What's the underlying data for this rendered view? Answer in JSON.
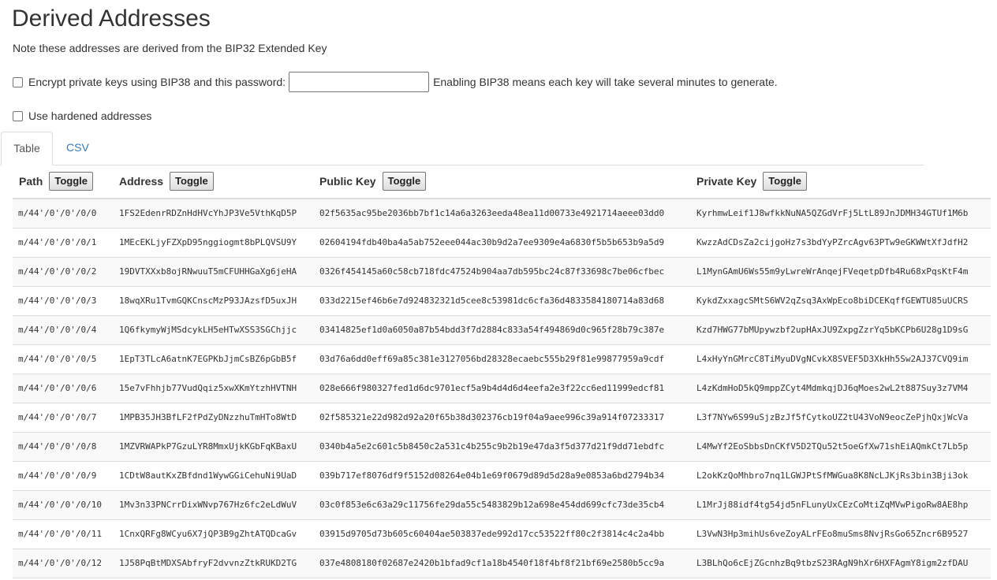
{
  "page": {
    "title": "Derived Addresses",
    "note": "Note these addresses are derived from the BIP32 Extended Key"
  },
  "options": {
    "bip38_label": "Encrypt private keys using BIP38 and this password:",
    "bip38_password_value": "",
    "bip38_hint": "Enabling BIP38 means each key will take several minutes to generate.",
    "hardened_label": "Use hardened addresses"
  },
  "tabs": [
    {
      "label": "Table",
      "active": true
    },
    {
      "label": "CSV",
      "active": false
    }
  ],
  "table": {
    "headers": {
      "path": "Path",
      "address": "Address",
      "public_key": "Public Key",
      "private_key": "Private Key",
      "toggle_label": "Toggle"
    },
    "rows": [
      {
        "path": "m/44'/0'/0'/0/0",
        "address": "1FS2EdenrRDZnHdHVcYhJP3Ve5VthKqD5P",
        "public_key": "02f5635ac95be2036bb7bf1c14a6a3263eeda48ea11d00733e4921714aeee03dd0",
        "private_key": "KyrhmwLeif1J8wfkkNuNA5QZGdVrFj5LtL89JnJDMH34GTUf1M6b"
      },
      {
        "path": "m/44'/0'/0'/0/1",
        "address": "1MEcEKLjyFZXpD95nggiogmt8bPLQVSU9Y",
        "public_key": "02604194fdb40ba4a5ab752eee044ac30b9d2a7ee9309e4a6830f5b5b653b9a5d9",
        "private_key": "KwzzAdCDsZa2cijgoHz7s3bdYyPZrcAgv63PTw9eGKWWtXfJdfH2"
      },
      {
        "path": "m/44'/0'/0'/0/2",
        "address": "19DVTXXxb8ojRNwuuT5mCFUHHGaXg6jeHA",
        "public_key": "0326f454145a60c58cb718fdc47524b904aa7db595bc24c87f33698c7be06cfbec",
        "private_key": "L1MynGAmU6Ws55m9yLwreWrAnqejFVeqetpDfb4Ru68xPqsKtF4m"
      },
      {
        "path": "m/44'/0'/0'/0/3",
        "address": "18wqXRu1TvmGQKCnscMzP93JAzsfD5uxJH",
        "public_key": "033d2215ef46b6e7d924832321d5cee8c53981dc6cfa36d4833584180714a83d68",
        "private_key": "KykdZxxagcSMtS6WV2qZsq3AxWpEco8biDCEKqffGEWTU85uUCRS"
      },
      {
        "path": "m/44'/0'/0'/0/4",
        "address": "1Q6fkymyWjMSdcykLH5eHTwXSS3SGChjjc",
        "public_key": "03414825ef1d0a6050a87b54bdd3f7d2884c833a54f494869d0c965f28b79c387e",
        "private_key": "Kzd7HWG77bMUpywzbf2upHAxJU9ZxpgZzrYq5bKCPb6U28g1D9sG"
      },
      {
        "path": "m/44'/0'/0'/0/5",
        "address": "1EpT3TLcA6atnK7EGPKbJjmCsBZ6pGbB5f",
        "public_key": "03d76a6dd0eff69a85c381e3127056bd28328ecaebc555b29f81e99877959a9cdf",
        "private_key": "L4xHyYnGMrcC8TiMyuDVgNCvkX8SVEF5D3XkHh5Sw2AJ37CVQ9im"
      },
      {
        "path": "m/44'/0'/0'/0/6",
        "address": "15e7vFhhjb77VudQqiz5xwXKmYtzhHVTNH",
        "public_key": "028e666f980327fed1d6dc9701ecf5a9b4d4d6d4eefa2e3f22cc6ed11999edcf81",
        "private_key": "L4zKdmHoD5kQ9mppZCyt4MdmkqjDJ6qMoes2wL2t887Suy3z7VM4"
      },
      {
        "path": "m/44'/0'/0'/0/7",
        "address": "1MPB35JH3BfLF2fPdZyDNzzhuTmHTo8WtD",
        "public_key": "02f585321e22d982d92a20f65b38d302376cb19f04a9aee996c39a914f07233317",
        "private_key": "L3f7NYw6S99uSjzBzJf5fCytkoUZ2tU43VoN9eocZePjhQxjWcVa"
      },
      {
        "path": "m/44'/0'/0'/0/8",
        "address": "1MZVRWAPkP7GzuLYR8MmxUjkKGbFqKBaxU",
        "public_key": "0340b4a5e2c601c5b8450c2a531c4b255c9b2b19e47da3f5d377d21f9dd71ebdfc",
        "private_key": "L4MwYf2EoSbbsDnCKfV5D2TQu52t5oeGfXw71shEiAQmkCt7Lb5p"
      },
      {
        "path": "m/44'/0'/0'/0/9",
        "address": "1CDtW8autKxZBfdnd1WywGGiCehuNi9UaD",
        "public_key": "039b717ef8076df9f5152d08264e04b1e69f0679d89d5d28a9e0853a6bd2794b34",
        "private_key": "L2okKzQoMhbro7nq1LGWJPtSfMWGua8K8NcLJKjRs3bin3Bji3ok"
      },
      {
        "path": "m/44'/0'/0'/0/10",
        "address": "1Mv3n33PNCrrDixWNvp767Hz6fc2eLdWuV",
        "public_key": "03c0f853e6c63a29c11756fe29da55c5483829b12a698e454dd699cfc73de35cb4",
        "private_key": "L1MrJj88idf4tg54jd5nFLunyUxCEzCoMtiZqMVwPigoRw8AE8hp"
      },
      {
        "path": "m/44'/0'/0'/0/11",
        "address": "1CnxQRFg8WCyu6X7jQP3B9gZhtATQDcaGv",
        "public_key": "03915d9705d73b605c60404ae503837ede992d17cc53522ff80c2f3814c4c2a4bb",
        "private_key": "L3VwN3Hp3mihUs6veZoyALrFEo8muSms8NvjRsGo65Zncr6B9527"
      },
      {
        "path": "m/44'/0'/0'/0/12",
        "address": "1J58PqBtMDXSAbfryF2dvvnzZtkRUKD2TG",
        "public_key": "037e4808180f02687e2420b1bfad9cf1a18b4540f18f4bf8f21bf69e2580b5cc9a",
        "private_key": "L3BLhQo6cEjZGcnhzBq9tbzS23RAgN9hXr6HXFAgmY8igm2zfDAU"
      }
    ]
  }
}
